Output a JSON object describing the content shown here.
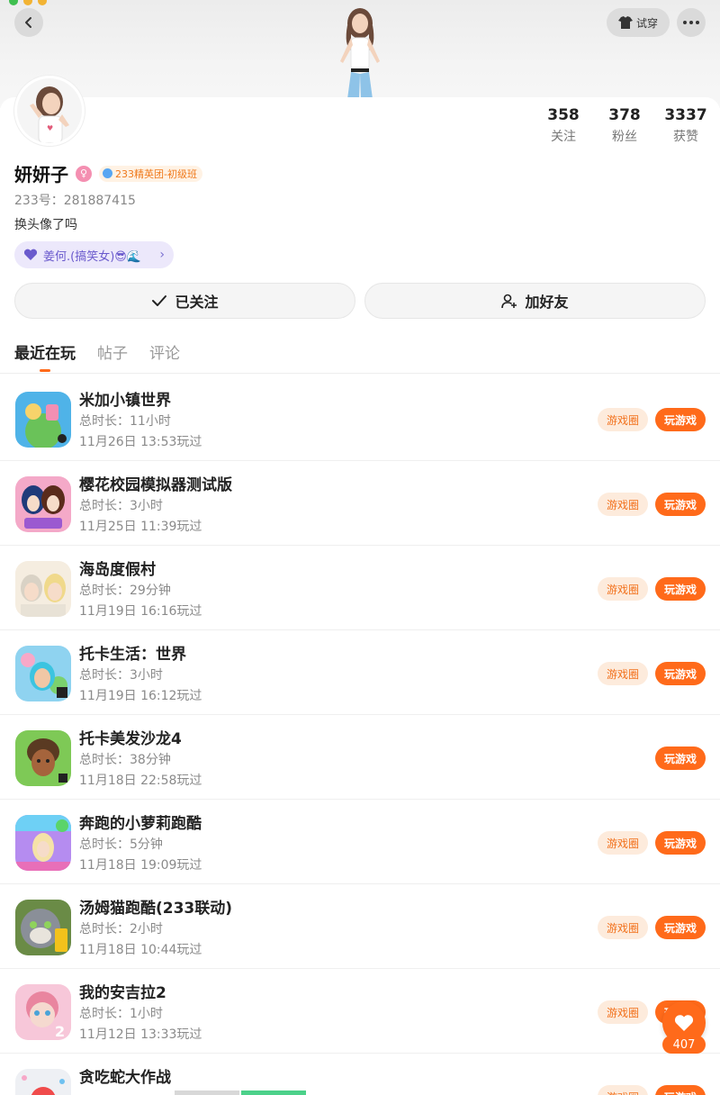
{
  "header": {
    "try_on_label": "试穿"
  },
  "profile": {
    "name": "妍妍子",
    "badge": "233精英团-初级班",
    "uid": "233号：281887415",
    "bio": "换头像了吗",
    "cp_tag": "姜何.(搞笑女)😎🌊",
    "stats": [
      {
        "value": "358",
        "label": "关注"
      },
      {
        "value": "378",
        "label": "粉丝"
      },
      {
        "value": "3337",
        "label": "获赞"
      }
    ]
  },
  "actions": {
    "followed_label": "已关注",
    "add_friend_label": "加好友"
  },
  "tabs": [
    "最近在玩",
    "帖子",
    "评论"
  ],
  "games": [
    {
      "title": "米加小镇世界",
      "duration": "总时长：11小时",
      "last_played": "11月26日 13:53玩过",
      "has_circle": true
    },
    {
      "title": "樱花校园模拟器测试版",
      "duration": "总时长：3小时",
      "last_played": "11月25日 11:39玩过",
      "has_circle": true
    },
    {
      "title": "海岛度假村",
      "duration": "总时长：29分钟",
      "last_played": "11月19日 16:16玩过",
      "has_circle": true
    },
    {
      "title": "托卡生活：世界",
      "duration": "总时长：3小时",
      "last_played": "11月19日 16:12玩过",
      "has_circle": true
    },
    {
      "title": "托卡美发沙龙4",
      "duration": "总时长：38分钟",
      "last_played": "11月18日 22:58玩过",
      "has_circle": false
    },
    {
      "title": "奔跑的小萝莉跑酷",
      "duration": "总时长：5分钟",
      "last_played": "11月18日 19:09玩过",
      "has_circle": true
    },
    {
      "title": "汤姆猫跑酷(233联动)",
      "duration": "总时长：2小时",
      "last_played": "11月18日 10:44玩过",
      "has_circle": true
    },
    {
      "title": "我的安吉拉2",
      "duration": "总时长：1小时",
      "last_played": "11月12日 13:33玩过",
      "has_circle": true
    },
    {
      "title": "贪吃蛇大作战",
      "duration": "",
      "last_played": "",
      "has_circle": true
    }
  ],
  "game_buttons": {
    "circle_label": "游戏圈",
    "play_label": "玩游戏"
  },
  "like_count": "407",
  "colors": {
    "accent": "#ff6a1a",
    "accent_light": "#fdebdc",
    "cp_tag_bg": "#ece8fb"
  }
}
